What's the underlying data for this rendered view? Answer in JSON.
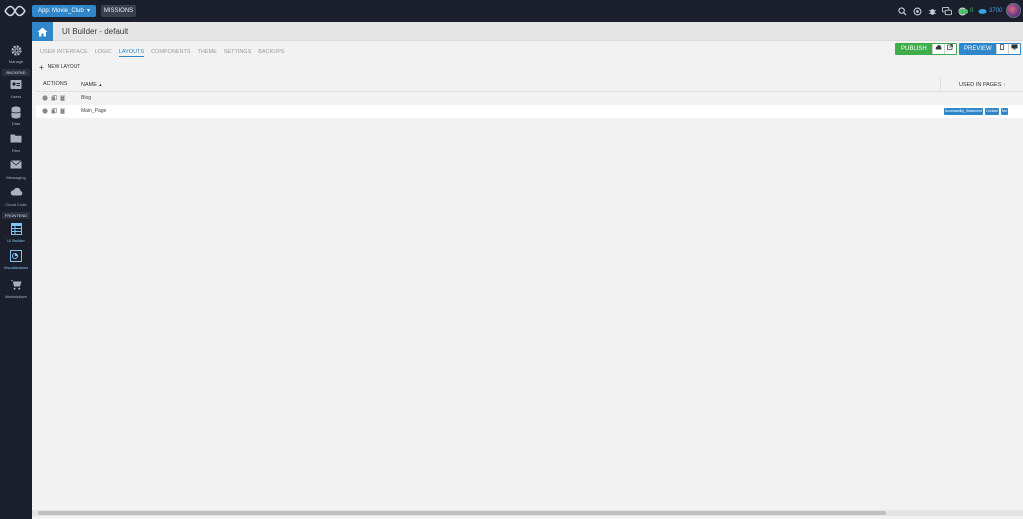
{
  "topbar": {
    "app_label": "App: Movie_Club",
    "missions_label": "MISSIONS",
    "icons": [
      "search-icon",
      "support-icon",
      "bug-icon",
      "chat-icon",
      "info-icon"
    ],
    "counter_green": "0",
    "counter_blue": "3700"
  },
  "sidebar": {
    "items": [
      {
        "label": "Manage",
        "icon": "gear-icon"
      },
      {
        "label": "Users",
        "icon": "users-icon"
      },
      {
        "label": "Data",
        "icon": "database-icon"
      },
      {
        "label": "Files",
        "icon": "folder-icon"
      },
      {
        "label": "Messaging",
        "icon": "envelope-icon"
      },
      {
        "label": "Cloud Code",
        "icon": "cloud-icon"
      },
      {
        "label": "UI Builder",
        "icon": "table-icon"
      },
      {
        "label": "Visualizations",
        "icon": "chart-icon"
      },
      {
        "label": "Marketplace",
        "icon": "cart-icon"
      }
    ],
    "sections": {
      "backend": "BACKEND",
      "frontend": "FRONTEND"
    }
  },
  "header": {
    "title": "UI Builder - default"
  },
  "tabs": [
    {
      "label": "USER INTERFACE"
    },
    {
      "label": "LOGIC"
    },
    {
      "label": "LAYOUTS"
    },
    {
      "label": "COMPONENTS"
    },
    {
      "label": "THEME"
    },
    {
      "label": "SETTINGS"
    },
    {
      "label": "BACKUPS"
    }
  ],
  "actions": {
    "publish_label": "PUBLISH",
    "preview_label": "PREVIEW"
  },
  "toolbar": {
    "new_layout_label": "NEW LAYOUT"
  },
  "table": {
    "headers": {
      "actions": "ACTIONS",
      "name": "NAME",
      "sort": "▲",
      "used": "USED IN PAGES",
      "used_sort": "⇕"
    },
    "rows": [
      {
        "name": "Blog",
        "pages": []
      },
      {
        "name": "Main_Page",
        "pages": [
          "Accessibility_Statement",
          "Contact",
          "Mo"
        ]
      }
    ]
  }
}
